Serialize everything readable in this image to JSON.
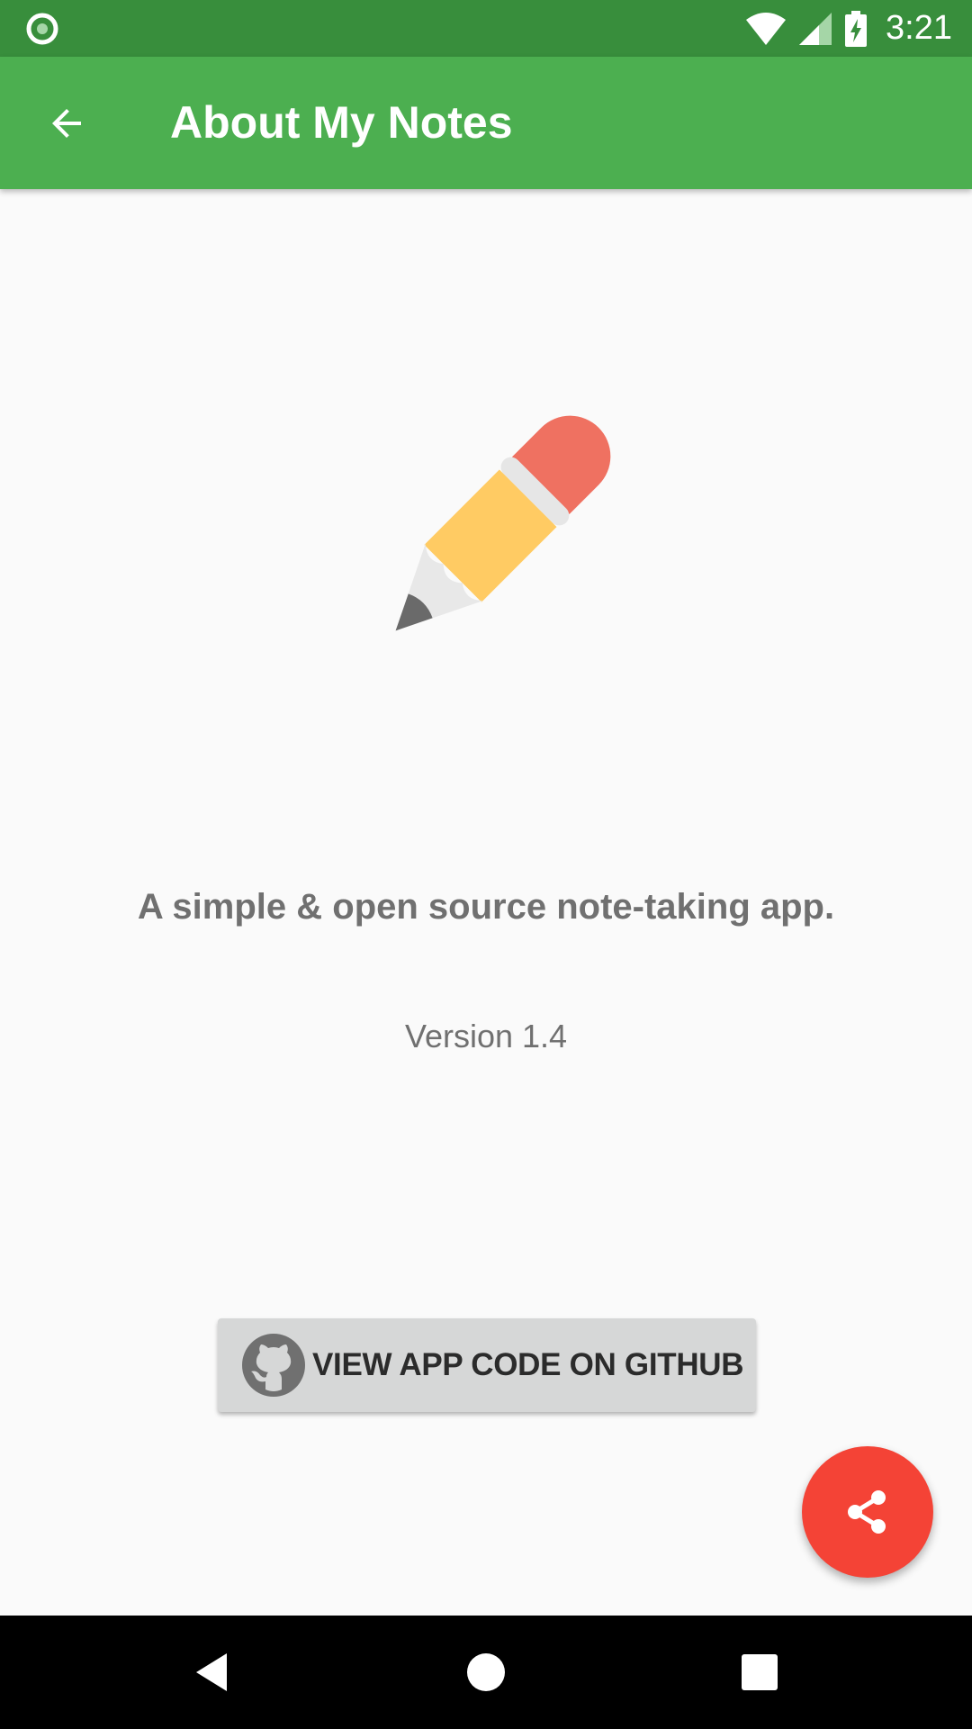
{
  "status_bar": {
    "time": "3:21",
    "notification_icon": "circle-notification-icon",
    "icons": [
      "wifi-icon",
      "signal-icon",
      "battery-charging-icon"
    ]
  },
  "app_bar": {
    "title": "About My Notes",
    "back_icon": "arrow-back-icon",
    "background_color": "#4caf50",
    "status_color": "#388e3c"
  },
  "content": {
    "logo_icon": "pencil-icon",
    "tagline": "A simple & open source note-taking app.",
    "version": "Version 1.4",
    "github_button": {
      "label": "VIEW APP CODE ON GITHUB",
      "icon": "github-icon"
    },
    "share_fab": {
      "icon": "share-icon",
      "color": "#f44336"
    }
  },
  "nav_bar": {
    "buttons": [
      "back-triangle-icon",
      "home-circle-icon",
      "recents-square-icon"
    ]
  }
}
